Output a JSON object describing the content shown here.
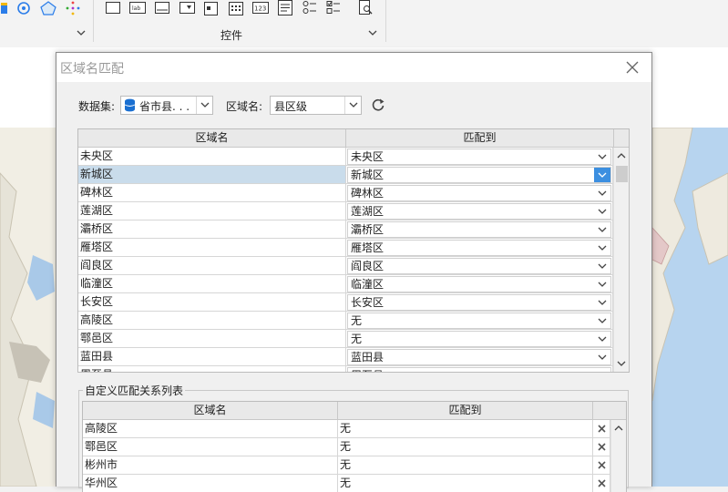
{
  "ribbon": {
    "group_label": "控件",
    "control_icons": [
      "textbox-icon",
      "label-icon",
      "button-icon",
      "combobox-icon",
      "datetime-icon",
      "calendar-icon",
      "number-icon",
      "textarea-icon",
      "radiolist-icon",
      "checklist-icon",
      "browse-icon"
    ],
    "mini_icons": [
      "color-icon",
      "web-icon",
      "theme-icon"
    ]
  },
  "dialog": {
    "title": "区域名匹配",
    "dataset_label": "数据集:",
    "dataset_value": "省市县. . .",
    "field_label": "区域名:",
    "field_value": "县区级",
    "refresh_icon": "refresh-icon",
    "close_icon": "close-icon",
    "match_table": {
      "col_name": "区域名",
      "col_match": "匹配到",
      "rows": [
        {
          "name": "未央区",
          "match": "未央区"
        },
        {
          "name": "新城区",
          "match": "新城区"
        },
        {
          "name": "碑林区",
          "match": "碑林区"
        },
        {
          "name": "莲湖区",
          "match": "莲湖区"
        },
        {
          "name": "灞桥区",
          "match": "灞桥区"
        },
        {
          "name": "雁塔区",
          "match": "雁塔区"
        },
        {
          "name": "阎良区",
          "match": "阎良区"
        },
        {
          "name": "临潼区",
          "match": "临潼区"
        },
        {
          "name": "长安区",
          "match": "长安区"
        },
        {
          "name": "高陵区",
          "match": "无"
        },
        {
          "name": "鄠邑区",
          "match": "无"
        },
        {
          "name": "蓝田县",
          "match": "蓝田县"
        },
        {
          "name": "周至县",
          "match": "周至县"
        }
      ],
      "selected_index": 1
    },
    "custom_group": {
      "title": "自定义匹配关系列表",
      "col_name": "区域名",
      "col_match": "匹配到",
      "rows": [
        {
          "name": "高陵区",
          "match": "无"
        },
        {
          "name": "鄠邑区",
          "match": "无"
        },
        {
          "name": "彬州市",
          "match": "无"
        },
        {
          "name": "华州区",
          "match": "无"
        }
      ]
    }
  },
  "colors": {
    "selected_row": "#c9dceb",
    "accent": "#3c8fe0",
    "dataset_icon": "#1a6fd1"
  }
}
